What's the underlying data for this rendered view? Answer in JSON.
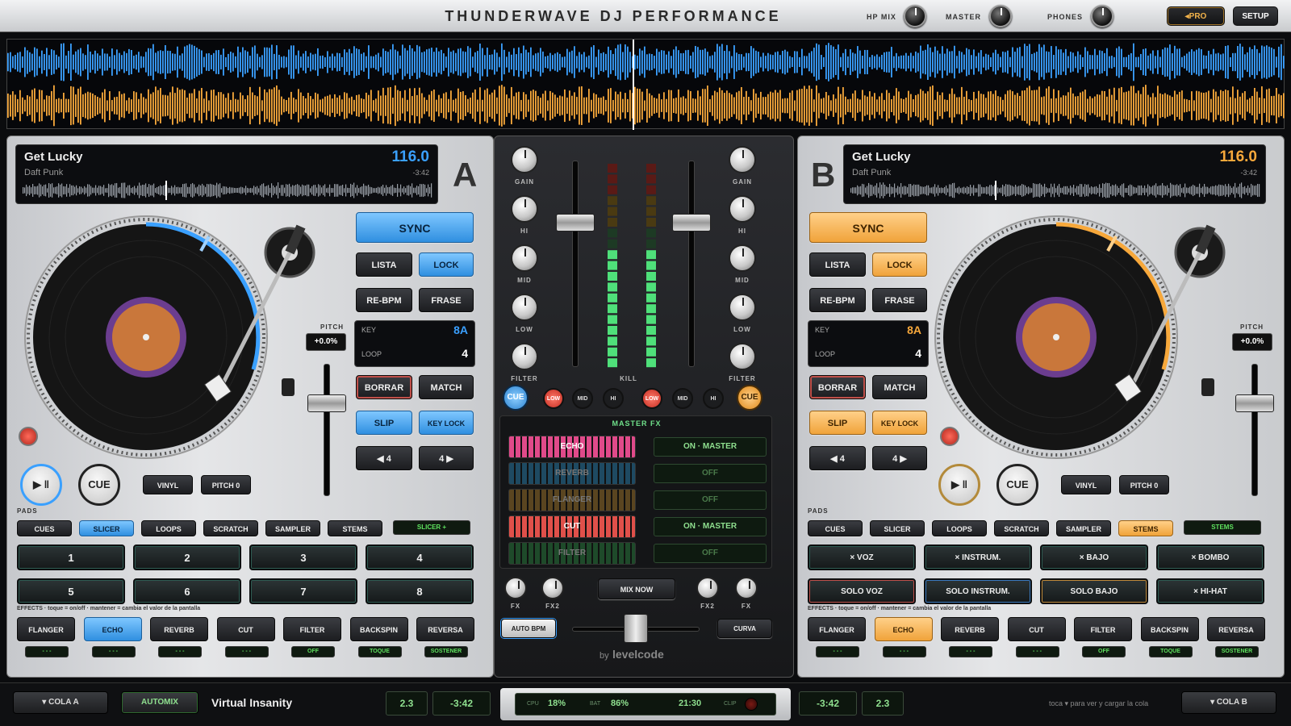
{
  "app": {
    "title": "THUNDERWAVE DJ PERFORMANCE",
    "hp_mix": "HP MIX",
    "master": "MASTER",
    "phones": "PHONES",
    "pro": "◂PRO",
    "setup": "SETUP"
  },
  "colors": {
    "deck_a": "#3aa0ff",
    "deck_b": "#f7a83b"
  },
  "deck_a": {
    "letter": "A",
    "title": "Get Lucky",
    "artist": "Daft Punk",
    "bpm": "116.0",
    "time": "-3:42",
    "key_label": "KEY",
    "key": "8A",
    "loop_label": "LOOP",
    "loop": "4",
    "pitch_label": "PITCH",
    "pitch": "+0.0%",
    "sync": "SYNC",
    "lista": "LISTA",
    "lock": "LOCK",
    "rebpm": "RE-BPM",
    "frase": "FRASE",
    "borrar": "BORRAR",
    "match": "MATCH",
    "slip": "SLIP",
    "keylock": "KEY LOCK",
    "back4": "◀ 4",
    "fwd4": "4 ▶",
    "play": "▶ ‖",
    "cue": "CUE",
    "vinyl": "VINYL",
    "pitch0": "PITCH 0",
    "pads_label": "PADS",
    "modes": [
      "CUES",
      "SLICER",
      "LOOPS",
      "SCRATCH",
      "SAMPLER",
      "STEMS"
    ],
    "mode_lcd": "SLICER  +",
    "pads": [
      "1",
      "2",
      "3",
      "4",
      "5",
      "6",
      "7",
      "8"
    ],
    "effects_hint": "EFFECTS · toque = on/off · mantener = cambia el valor de la pantalla",
    "effects": [
      "FLANGER",
      "ECHO",
      "REVERB",
      "CUT",
      "FILTER",
      "BACKSPIN",
      "REVERSA"
    ],
    "effect_lcds": [
      "- - -",
      "- - -",
      "- - -",
      "- - -",
      "OFF",
      "TOQUE",
      "SOSTENER"
    ]
  },
  "deck_b": {
    "letter": "B",
    "title": "Get Lucky",
    "artist": "Daft Punk",
    "bpm": "116.0",
    "time": "-3:42",
    "key_label": "KEY",
    "key": "8A",
    "loop_label": "LOOP",
    "loop": "4",
    "pitch_label": "PITCH",
    "pitch": "+0.0%",
    "sync": "SYNC",
    "lista": "LISTA",
    "lock": "LOCK",
    "rebpm": "RE-BPM",
    "frase": "FRASE",
    "borrar": "BORRAR",
    "match": "MATCH",
    "slip": "SLIP",
    "keylock": "KEY LOCK",
    "back4": "◀ 4",
    "fwd4": "4 ▶",
    "play": "▶ ‖",
    "cue": "CUE",
    "vinyl": "VINYL",
    "pitch0": "PITCH 0",
    "pads_label": "PADS",
    "modes": [
      "CUES",
      "SLICER",
      "LOOPS",
      "SCRATCH",
      "SAMPLER",
      "STEMS"
    ],
    "mode_lcd": "STEMS",
    "pads": [
      "× VOZ",
      "× INSTRUM.",
      "× BAJO",
      "× BOMBO",
      "SOLO VOZ",
      "SOLO INSTRUM.",
      "SOLO BAJO",
      "× HI-HAT"
    ],
    "effects_hint": "EFFECTS · toque = on/off · mantener = cambia el valor de la pantalla",
    "effects": [
      "FLANGER",
      "ECHO",
      "REVERB",
      "CUT",
      "FILTER",
      "BACKSPIN",
      "REVERSA"
    ],
    "effect_lcds": [
      "- - -",
      "- - -",
      "- - -",
      "- - -",
      "OFF",
      "TOQUE",
      "SOSTENER"
    ]
  },
  "mixer": {
    "gain": "GAIN",
    "hi": "HI",
    "mid": "MID",
    "low": "LOW",
    "filter": "FILTER",
    "kill": "KILL",
    "cue": "CUE",
    "k_low": "LOW",
    "k_mid": "MID",
    "k_hi": "HI",
    "master_fx": "MASTER FX",
    "fx": [
      {
        "name": "ECHO",
        "state": "ON · MASTER"
      },
      {
        "name": "REVERB",
        "state": "OFF"
      },
      {
        "name": "FLANGER",
        "state": "OFF"
      },
      {
        "name": "CUT",
        "state": "ON · MASTER"
      },
      {
        "name": "FILTER",
        "state": "OFF"
      }
    ],
    "fx1": "FX",
    "fx2": "FX2",
    "mix_now": "MIX NOW",
    "auto_bpm": "AUTO BPM",
    "curva": "CURVA",
    "brand_by": "by",
    "brand": "levelcode"
  },
  "bottom": {
    "cola_a": "▾ COLA A",
    "automix": "AUTOMIX",
    "track": "Virtual Insanity",
    "a_val": "2.3",
    "a_time": "-3:42",
    "cpu_label": "CPU",
    "cpu": "18%",
    "bat_label": "BAT",
    "bat": "86%",
    "clock": "21:30",
    "clip_label": "CLIP",
    "b_time": "-3:42",
    "b_val": "2.3",
    "hint": "toca ▾ para ver y cargar la cola",
    "cola_b": "▾ COLA B"
  }
}
